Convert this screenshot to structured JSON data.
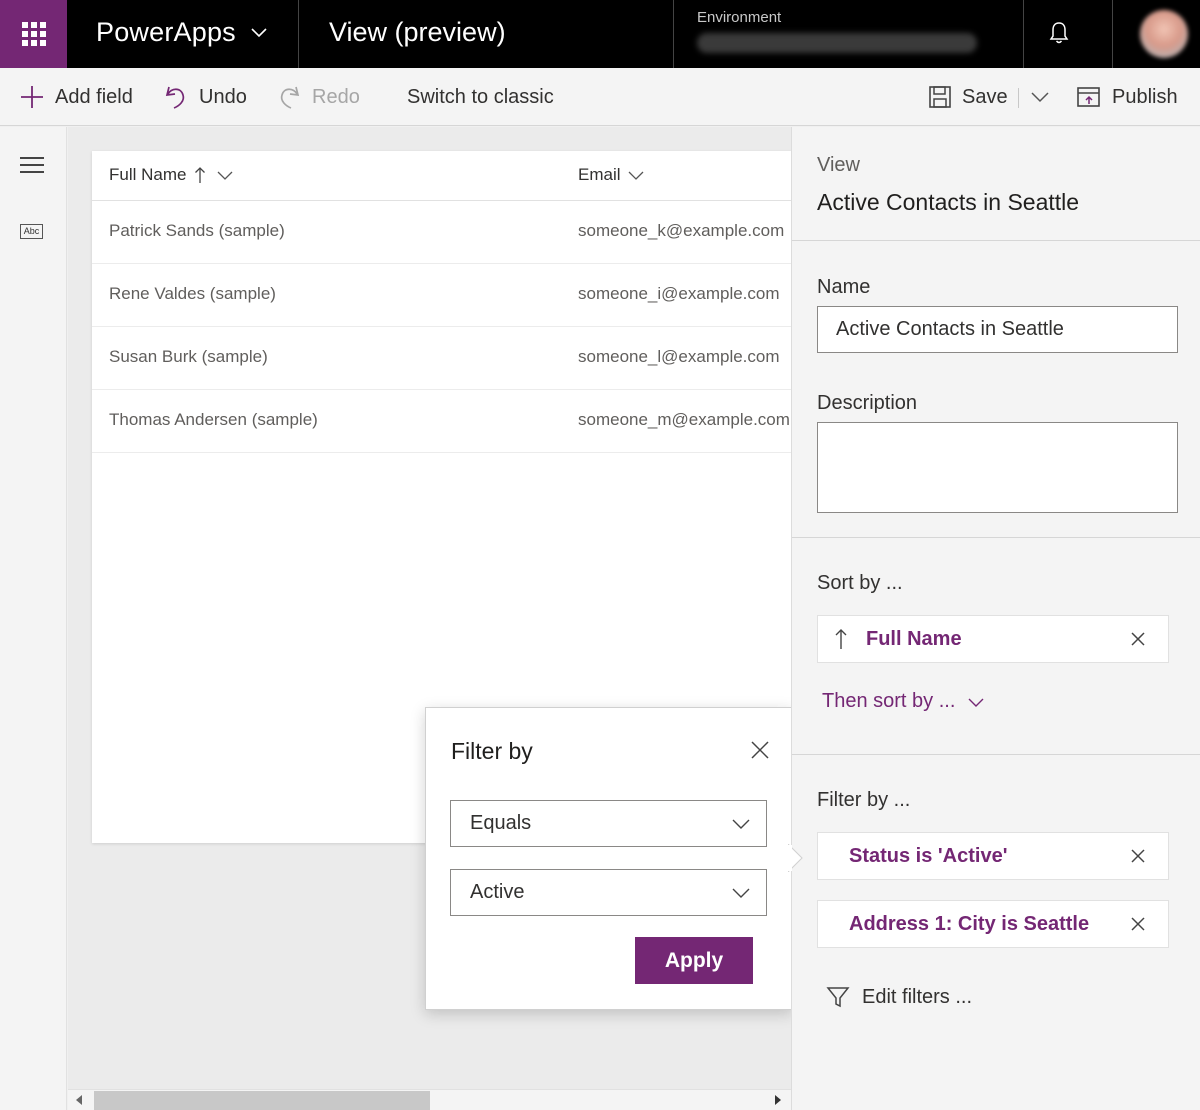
{
  "header": {
    "app_name": "PowerApps",
    "view_title": "View (preview)",
    "environment_label": "Environment",
    "environment_value": ""
  },
  "commands": {
    "add_field": "Add field",
    "undo": "Undo",
    "redo": "Redo",
    "switch_classic": "Switch to classic",
    "save": "Save",
    "publish": "Publish"
  },
  "grid": {
    "columns": [
      "Full Name",
      "Email"
    ],
    "rows": [
      {
        "full_name": "Patrick Sands (sample)",
        "email": "someone_k@example.com"
      },
      {
        "full_name": "Rene Valdes (sample)",
        "email": "someone_i@example.com"
      },
      {
        "full_name": "Susan Burk (sample)",
        "email": "someone_l@example.com"
      },
      {
        "full_name": "Thomas Andersen (sample)",
        "email": "someone_m@example.com"
      }
    ]
  },
  "filter_popup": {
    "title": "Filter by",
    "operator_value": "Equals",
    "value_value": "Active",
    "apply_label": "Apply"
  },
  "panel": {
    "view_label": "View",
    "view_name": "Active Contacts in Seattle",
    "name_label": "Name",
    "name_value": "Active Contacts in Seattle",
    "description_label": "Description",
    "description_value": "",
    "sort_label": "Sort by ...",
    "sort_items": [
      "Full Name"
    ],
    "then_sort_label": "Then sort by ...",
    "filter_label": "Filter by ...",
    "filter_items": [
      "Status is 'Active'",
      "Address 1: City is Seattle"
    ],
    "edit_filters_label": "Edit filters ..."
  },
  "colors": {
    "brand": "#742774",
    "topbar": "#000000",
    "panel_bg": "#f4f4f4"
  },
  "icons": [
    "waffle-icon",
    "chevron-down-icon",
    "bell-icon",
    "plus-icon",
    "undo-icon",
    "redo-icon",
    "save-icon",
    "publish-icon",
    "hamburger-icon",
    "text-field-icon",
    "sort-ascending-icon",
    "close-icon",
    "filter-icon"
  ]
}
